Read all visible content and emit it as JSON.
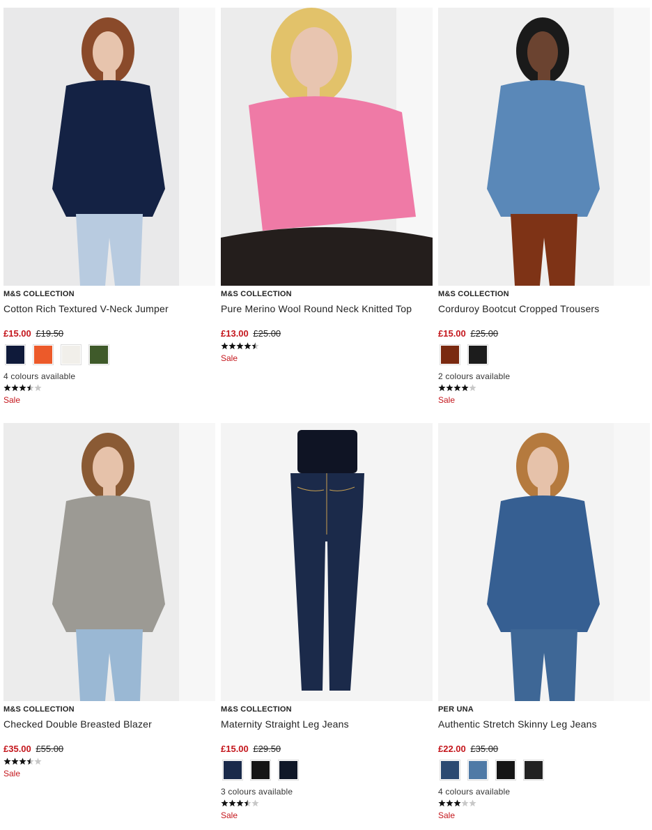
{
  "products": [
    {
      "brand": "M&S COLLECTION",
      "title": "Cotton Rich Textured V-Neck Jumper",
      "price_now": "£15.00",
      "price_was": "£19.50",
      "swatches": [
        "#0f1a3a",
        "#ec5a2a",
        "#f1efea",
        "#3f5a2a"
      ],
      "colours_text": "4 colours available",
      "rating": 3.5,
      "sale": "Sale",
      "image": {
        "bg": "#e9e9ea",
        "garment": "#142244",
        "skin": "#e7c4ad",
        "hair": "#8a4a2a",
        "lower": "#b8cbe0"
      }
    },
    {
      "brand": "M&S COLLECTION",
      "title": "Pure Merino Wool Round Neck Knitted Top",
      "price_now": "£13.00",
      "price_was": "£25.00",
      "swatches": [],
      "colours_text": "",
      "rating": 4.5,
      "sale": "Sale",
      "image": {
        "bg": "#ececec",
        "garment": "#ef7aa6",
        "skin": "#e8c5b0",
        "hair": "#e2c26a",
        "lower": "#241e1c"
      }
    },
    {
      "brand": "M&S COLLECTION",
      "title": "Corduroy Bootcut Cropped Trousers",
      "price_now": "£15.00",
      "price_was": "£25.00",
      "swatches": [
        "#7a2a10",
        "#1c1c1c"
      ],
      "colours_text": "2 colours available",
      "rating": 4,
      "sale": "Sale",
      "image": {
        "bg": "#efefef",
        "garment": "#5a88b8",
        "skin": "#6b4330",
        "hair": "#1a1a1a",
        "lower": "#7e3316"
      }
    },
    {
      "brand": "M&S COLLECTION",
      "title": "Checked Double Breasted Blazer",
      "price_now": "£35.00",
      "price_was": "£55.00",
      "swatches": [],
      "colours_text": "",
      "rating": 3.5,
      "sale": "Sale",
      "image": {
        "bg": "#ececec",
        "garment": "#9c9a94",
        "skin": "#e6c2aa",
        "hair": "#8a5a34",
        "lower": "#9ab8d4"
      }
    },
    {
      "brand": "M&S COLLECTION",
      "title": "Maternity Straight Leg Jeans",
      "price_now": "£15.00",
      "price_was": "£29.50",
      "swatches": [
        "#1a2a4a",
        "#151515",
        "#101828"
      ],
      "colours_text": "3 colours available",
      "rating": 3.5,
      "sale": "Sale",
      "image": {
        "bg": "#f4f4f4",
        "garment": "#1b2a4a",
        "skin": "#f4f4f4",
        "hair": "#0f1424",
        "lower": "#1b2a4a"
      }
    },
    {
      "brand": "PER UNA",
      "title": "Authentic Stretch Skinny Leg Jeans",
      "price_now": "£22.00",
      "price_was": "£35.00",
      "swatches": [
        "#2c4a72",
        "#4f7aa6",
        "#151515",
        "#222222"
      ],
      "colours_text": "4 colours available",
      "rating": 3,
      "sale": "Sale",
      "image": {
        "bg": "#f3f3f3",
        "garment": "#365f92",
        "skin": "#e6c2aa",
        "hair": "#b57a3e",
        "lower": "#3e6796"
      }
    }
  ]
}
